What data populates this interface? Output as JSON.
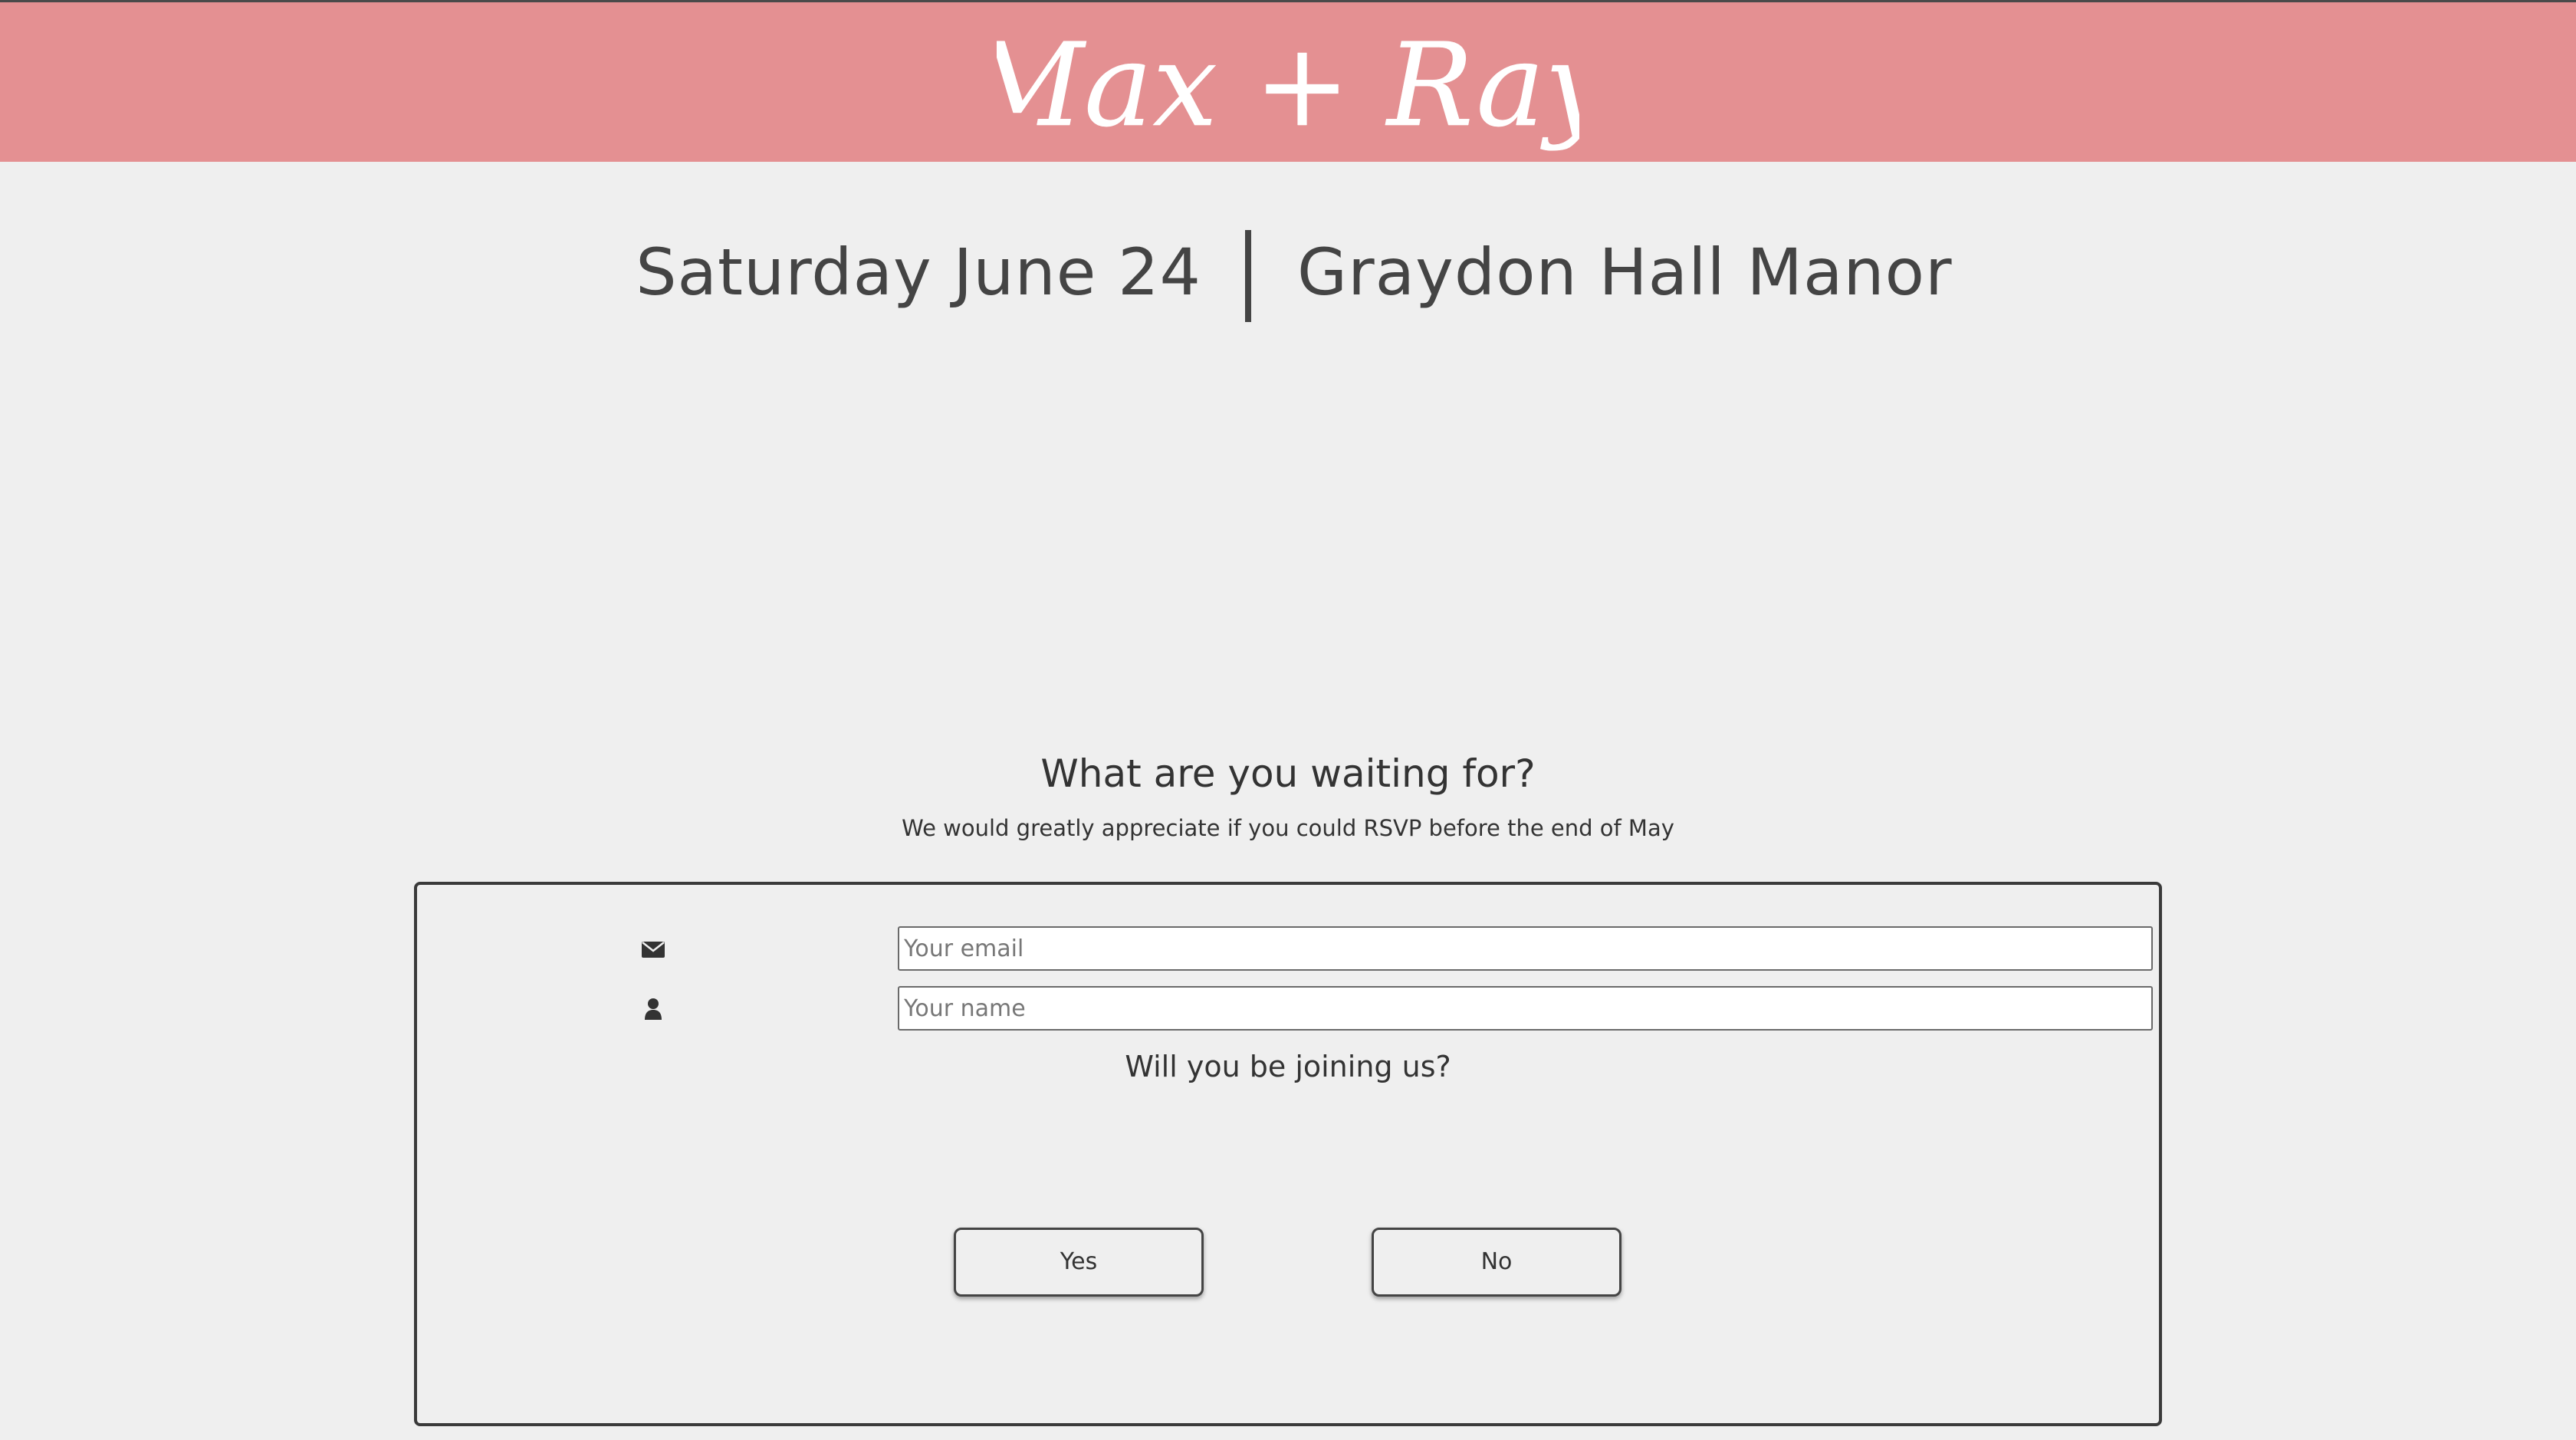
{
  "header": {
    "logo_text": "Max + Ray",
    "background_color": "#e49092"
  },
  "event": {
    "date": "Saturday June 24",
    "venue": "Graydon Hall Manor"
  },
  "rsvp": {
    "title": "What are you waiting for?",
    "subtitle": "We would greatly appreciate if you could RSVP before the end of May",
    "email_placeholder": "Your email",
    "email_icon": "envelope-icon",
    "name_placeholder": "Your name",
    "name_icon": "user-icon",
    "question": "Will you be joining us?",
    "yes_label": "Yes",
    "no_label": "No"
  }
}
